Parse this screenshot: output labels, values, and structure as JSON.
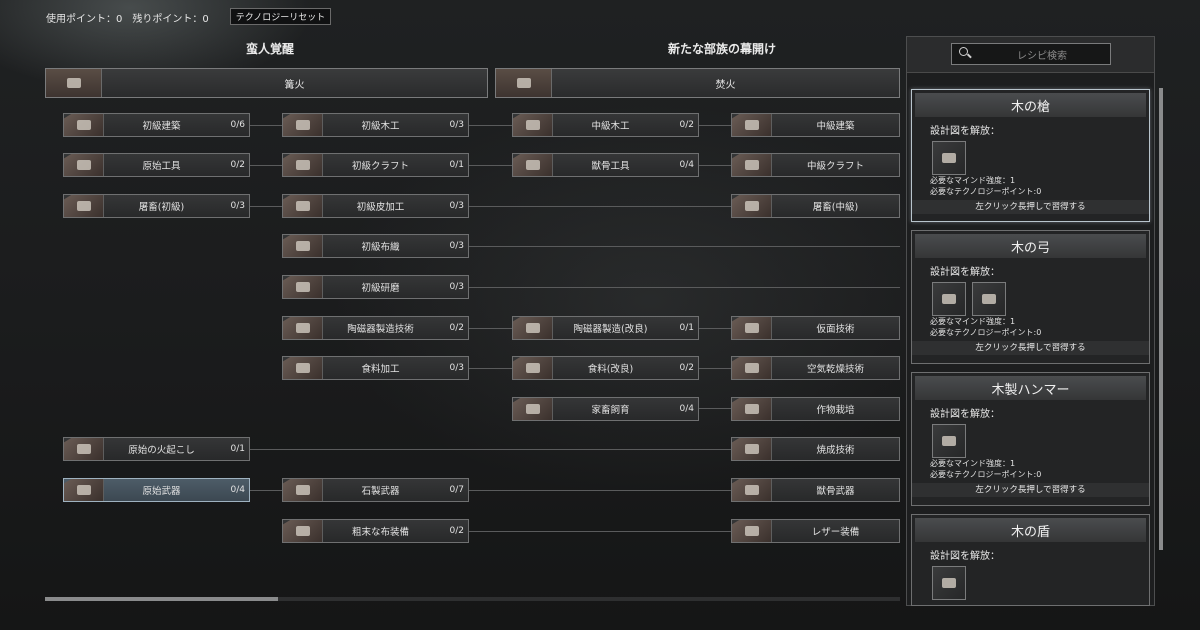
{
  "header": {
    "used_points": "使用ポイント：0",
    "remaining_points": "残りポイント：0",
    "reset_button": "テクノロジーリセット"
  },
  "eras": [
    {
      "title": "蛮人覚醒",
      "root": "篝火"
    },
    {
      "title": "新たな部族の幕開け",
      "root": "焚火"
    }
  ],
  "nodes": {
    "c1": [
      {
        "label": "初級建築",
        "count": "0/6"
      },
      {
        "label": "原始工具",
        "count": "0/2"
      },
      {
        "label": "屠畜(初級)",
        "count": "0/3"
      },
      {
        "label": "原始の火起こし",
        "count": "0/1"
      },
      {
        "label": "原始武器",
        "count": "0/4"
      }
    ],
    "c2": [
      {
        "label": "初級木工",
        "count": "0/3"
      },
      {
        "label": "初級クラフト",
        "count": "0/1"
      },
      {
        "label": "初級皮加工",
        "count": "0/3"
      },
      {
        "label": "初級布織",
        "count": "0/3"
      },
      {
        "label": "初級研磨",
        "count": "0/3"
      },
      {
        "label": "陶磁器製造技術",
        "count": "0/2"
      },
      {
        "label": "食料加工",
        "count": "0/3"
      },
      {
        "label": "石製武器",
        "count": "0/7"
      },
      {
        "label": "粗末な布装備",
        "count": "0/2"
      }
    ],
    "c3": [
      {
        "label": "中級木工",
        "count": "0/2"
      },
      {
        "label": "獣骨工具",
        "count": "0/4"
      },
      {
        "label": "陶磁器製造(改良)",
        "count": "0/1"
      },
      {
        "label": "食料(改良)",
        "count": "0/2"
      },
      {
        "label": "家畜飼育",
        "count": "0/4"
      }
    ],
    "c4": [
      {
        "label": "中級建築"
      },
      {
        "label": "中級クラフト"
      },
      {
        "label": "屠畜(中級)"
      },
      {
        "label": "仮面技術"
      },
      {
        "label": "空気乾燥技術"
      },
      {
        "label": "作物栽培"
      },
      {
        "label": "焼成技術"
      },
      {
        "label": "獣骨武器"
      },
      {
        "label": "レザー装備"
      }
    ]
  },
  "panel": {
    "search_placeholder": "レシピ検索",
    "cards": [
      {
        "title": "木の槍",
        "unlock": "設計図を解放：",
        "mind": "必要なマインド強度：1",
        "tech": "必要なテクノロジーポイント:0",
        "action": "左クリック長押しで習得する"
      },
      {
        "title": "木の弓",
        "unlock": "設計図を解放：",
        "mind": "必要なマインド強度：1",
        "tech": "必要なテクノロジーポイント:0",
        "action": "左クリック長押しで習得する"
      },
      {
        "title": "木製ハンマー",
        "unlock": "設計図を解放：",
        "mind": "必要なマインド強度：1",
        "tech": "必要なテクノロジーポイント:0",
        "action": "左クリック長押しで習得する"
      },
      {
        "title": "木の盾",
        "unlock": "設計図を解放："
      }
    ]
  },
  "colors": {
    "selected_node": "#4d5c68",
    "panel_border": "#b8c4cc"
  }
}
